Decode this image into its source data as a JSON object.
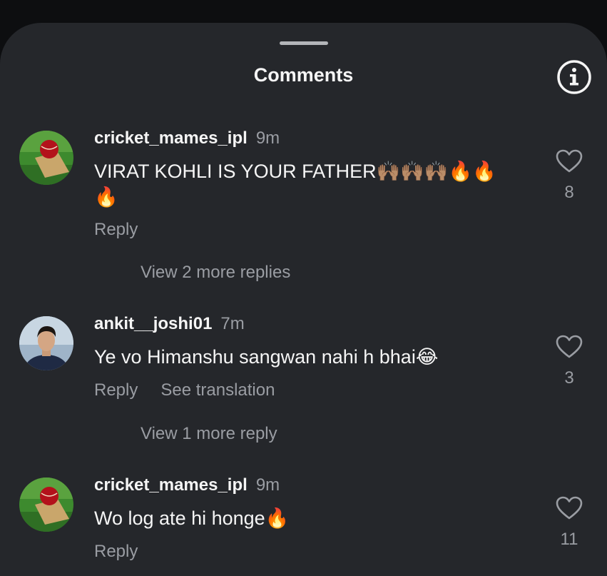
{
  "header": {
    "title": "Comments",
    "info_icon": "info-icon"
  },
  "comments": [
    {
      "username": "cricket_mames_ipl",
      "time": "9m",
      "text": "VIRAT KOHLI IS YOUR FATHER",
      "emoji_line1": "🙌🏽🙌🏽🙌🏽🔥🔥",
      "emoji_line2": "🔥",
      "reply_label": "Reply",
      "likes": "8",
      "view_replies": "View 2 more replies"
    },
    {
      "username": "ankit__joshi01",
      "time": "7m",
      "text": "Ye vo Himanshu sangwan nahi h bhai",
      "emoji": "😂",
      "reply_label": "Reply",
      "translate_label": "See translation",
      "likes": "3",
      "view_replies": "View 1 more reply"
    },
    {
      "username": "cricket_mames_ipl",
      "time": "9m",
      "text": "Wo log ate hi honge",
      "emoji": "🔥",
      "reply_label": "Reply",
      "likes": "11"
    }
  ],
  "colors": {
    "sheet": "#25272b",
    "secondary_text": "#9a9da3",
    "primary_text": "#f5f5f5"
  }
}
